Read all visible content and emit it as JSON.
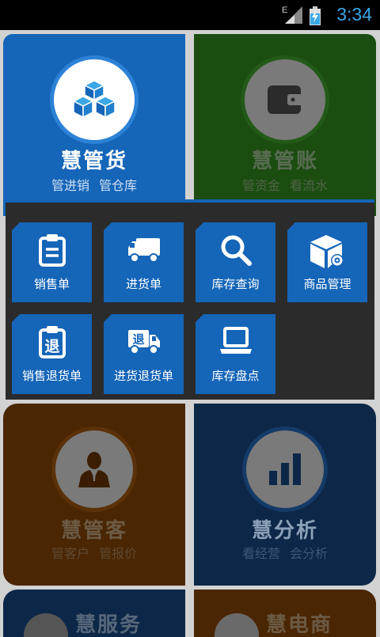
{
  "status_bar": {
    "network_type": "E",
    "time": "3:34",
    "icons": [
      "signal-icon",
      "battery-charging-icon"
    ]
  },
  "tiles": {
    "goods": {
      "title": "慧管货",
      "sub1": "管进销",
      "sub2": "管仓库",
      "icon": "boxes-icon",
      "color": "#1565b8"
    },
    "account": {
      "title": "慧管账",
      "sub1": "管资金",
      "sub2": "看流水",
      "icon": "wallet-icon",
      "color": "#1b4d11"
    },
    "customer": {
      "title": "慧管客",
      "sub1": "管客户",
      "sub2": "管报价",
      "icon": "person-icon",
      "color": "#4a2603"
    },
    "analysis": {
      "title": "慧分析",
      "sub1": "看经营",
      "sub2": "会分析",
      "icon": "bar-chart-icon",
      "color": "#0d2748"
    },
    "service": {
      "title": "慧服务",
      "icon": "service-icon",
      "color": "#0d2748"
    },
    "ecommerce": {
      "title": "慧电商",
      "icon": "ecommerce-icon",
      "color": "#4a2603"
    }
  },
  "submenu": {
    "items": [
      {
        "label": "销售单",
        "icon": "clipboard-icon"
      },
      {
        "label": "进货单",
        "icon": "truck-icon"
      },
      {
        "label": "库存查询",
        "icon": "search-icon"
      },
      {
        "label": "商品管理",
        "icon": "box-gear-icon"
      },
      {
        "label": "销售退货单",
        "icon": "return-clipboard-icon"
      },
      {
        "label": "进货退货单",
        "icon": "return-truck-icon"
      },
      {
        "label": "库存盘点",
        "icon": "laptop-icon"
      }
    ],
    "return_glyph": "退"
  }
}
